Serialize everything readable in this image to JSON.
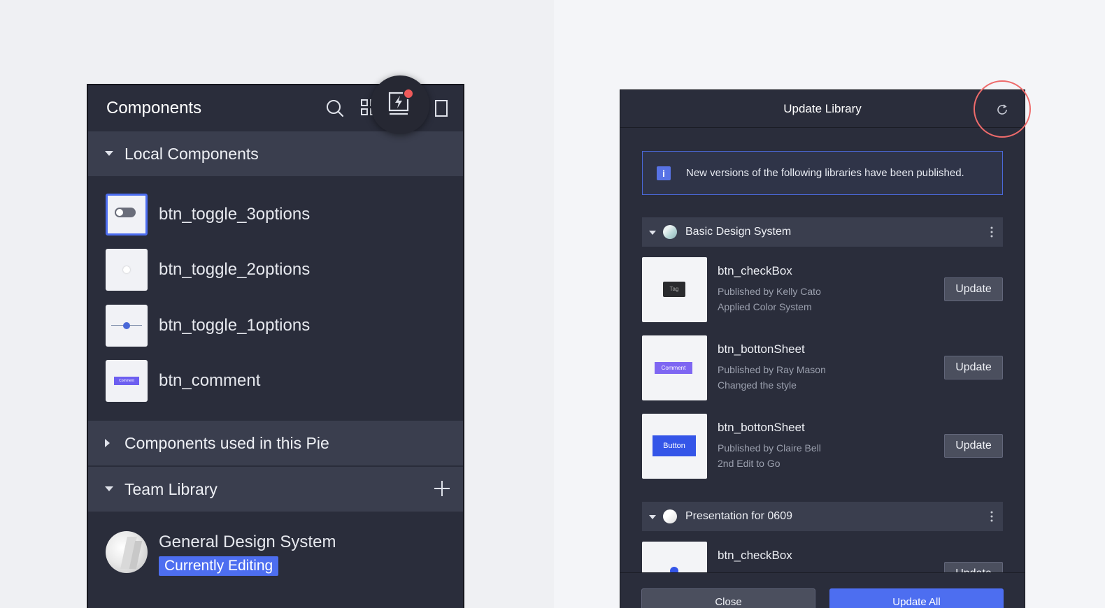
{
  "left_panel": {
    "title": "Components",
    "icons": [
      "search-icon",
      "grid-icon",
      "library-update-icon",
      "panel-icon"
    ],
    "sections": {
      "local": "Local Components",
      "used": "Components used in this Pie",
      "team": "Team Library"
    },
    "components": [
      {
        "name": "btn_toggle_3options",
        "selected": true
      },
      {
        "name": "btn_toggle_2options",
        "selected": false
      },
      {
        "name": "btn_toggle_1options",
        "selected": false
      },
      {
        "name": "btn_comment",
        "selected": false,
        "thumb_text": "Comment"
      }
    ],
    "team_library": {
      "name": "General Design System",
      "badge": "Currently Editing"
    }
  },
  "dialog": {
    "title": "Update Library",
    "info": "New versions of the following libraries have been published.",
    "groups": [
      {
        "name": "Basic Design System",
        "items": [
          {
            "name": "btn_checkBox",
            "publisher": "Published by Kelly Cato",
            "note": "Applied Color System",
            "thumb_text": "Tag",
            "button": "Update"
          },
          {
            "name": "btn_bottonSheet",
            "publisher": "Published by Ray Mason",
            "note": "Changed the style",
            "thumb_text": "Comment",
            "button": "Update"
          },
          {
            "name": "btn_bottonSheet",
            "publisher": "Published by Claire Bell",
            "note": "2nd Edit to Go",
            "thumb_text": "Button",
            "button": "Update"
          }
        ]
      },
      {
        "name": "Presentation for 0609",
        "items": [
          {
            "name": "btn_checkBox",
            "button": "Update"
          }
        ]
      }
    ],
    "footer": {
      "close": "Close",
      "update_all": "Update All"
    }
  },
  "colors": {
    "panel_bg": "#2a2d3b",
    "section_bg": "#3a3e4e",
    "accent": "#4d6ef0",
    "highlight_ring": "#ee6b6b",
    "notification": "#ef5a5a"
  }
}
